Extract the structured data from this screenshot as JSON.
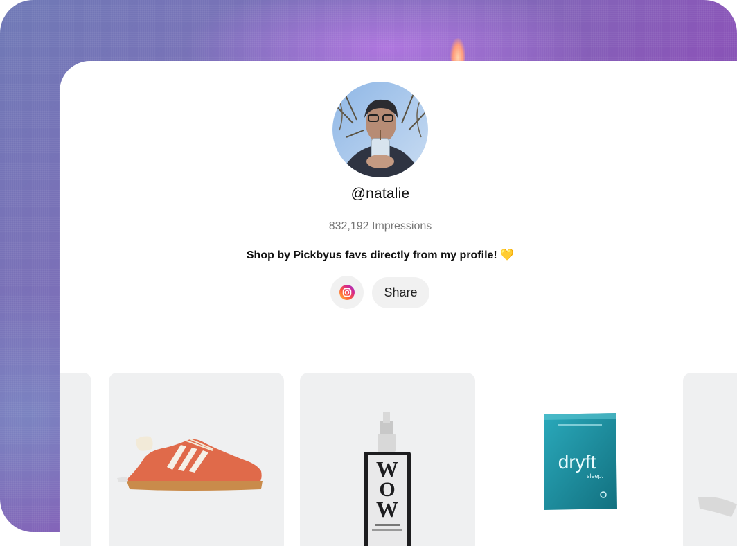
{
  "profile": {
    "username": "@natalie",
    "impressions": "832,192 Impressions",
    "bio": "Shop by Pickbyus favs directly from my profile!",
    "bio_emoji": "💛"
  },
  "actions": {
    "instagram_icon": "instagram-icon",
    "share_label": "Share"
  },
  "products": [
    {
      "name": "partial-product-left",
      "image": "product-image"
    },
    {
      "name": "orange-suede-sneaker",
      "image": "sneaker-image"
    },
    {
      "name": "serum-bottle",
      "image": "serum-bottle-image",
      "bottle_text": "WOW"
    },
    {
      "name": "dryft-pouch",
      "image": "pouch-image",
      "brand": "dryft",
      "sub": "sleep"
    },
    {
      "name": "partial-product-right",
      "image": "product-image"
    }
  ],
  "colors": {
    "background_purple": "#8a55b8",
    "card": "#ffffff",
    "tile": "#eff0f1",
    "sneaker": "#e06a4a",
    "pouch": "#2a9fb0",
    "heart": "#f6c53a"
  }
}
